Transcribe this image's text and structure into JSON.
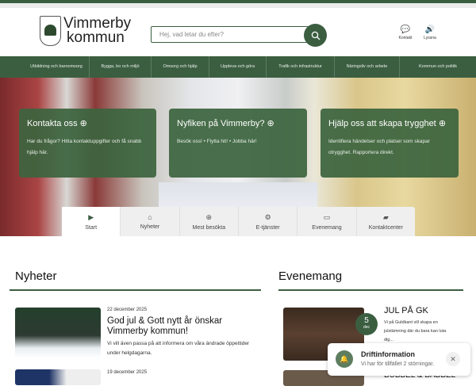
{
  "header": {
    "logo_line1": "Vimmerby",
    "logo_line2": "kommun",
    "search_placeholder": "Hej, vad letar du efter?",
    "contact": "Kontakt",
    "listen": "Lyssna"
  },
  "nav": [
    "Utbildning och barnomsorg",
    "Bygga, bo och miljö",
    "Omsorg och hjälp",
    "Uppleva och göra",
    "Trafik och infrastruktur",
    "Näringsliv och arbete",
    "Kommun och politik"
  ],
  "cards": [
    {
      "title": "Kontakta oss",
      "text": "Har du frågor? Hitta kontaktuppgifter och få snabb hjälp här."
    },
    {
      "title": "Nyfiken på Vimmerby?",
      "text": "Besök oss! • Flytta hit! • Jobba här!"
    },
    {
      "title": "Hjälp oss att skapa trygghet",
      "text": "Identifiera händelser och platser som skapar otrygghet. Rapportera direkt."
    }
  ],
  "tabs": [
    {
      "label": "Start",
      "icon": "play"
    },
    {
      "label": "Nyheter",
      "icon": "home"
    },
    {
      "label": "Mest besökta",
      "icon": "plus-circle"
    },
    {
      "label": "E-tjänster",
      "icon": "gears"
    },
    {
      "label": "Evenemang",
      "icon": "calendar"
    },
    {
      "label": "Kontaktcenter",
      "icon": "chat"
    }
  ],
  "news": {
    "heading": "Nyheter",
    "items": [
      {
        "date": "22 december 2025",
        "title": "God jul & Gott nytt år önskar Vimmerby kommun!",
        "desc": "Vi vill även passa på att informera om våra ändrade öppettider under helgdagarna."
      },
      {
        "date": "19 december 2025"
      }
    ]
  },
  "events": {
    "heading": "Evenemang",
    "items": [
      {
        "day": "5",
        "month": "dec",
        "title": "JUL PÅ GK",
        "desc": "Vi på Guldkant vill skapa en julstämning där du bara kan luta dig..."
      },
      {
        "title": "BUBBEL & BABBEL"
      }
    ]
  },
  "popup": {
    "title": "Driftinformation",
    "text": "Vi har för tillfället 2 störningar."
  },
  "colors": {
    "brand": "#3b5e41"
  }
}
